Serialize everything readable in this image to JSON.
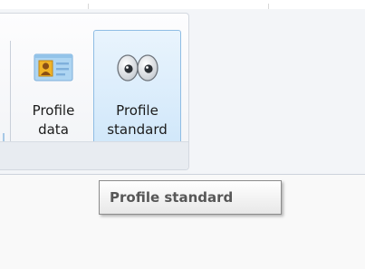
{
  "ribbon": {
    "buttons": [
      {
        "line1": "Profile",
        "line2": "data",
        "icon": "id-card-icon"
      },
      {
        "line1": "Profile",
        "line2": "standard",
        "icon": "eyes-icon",
        "state": "hover"
      }
    ]
  },
  "tooltip": {
    "text": "Profile standard"
  },
  "colors": {
    "hover_border": "#8fbde4",
    "hover_fill": "#d0e7fa",
    "tooltip_text": "#575757"
  }
}
